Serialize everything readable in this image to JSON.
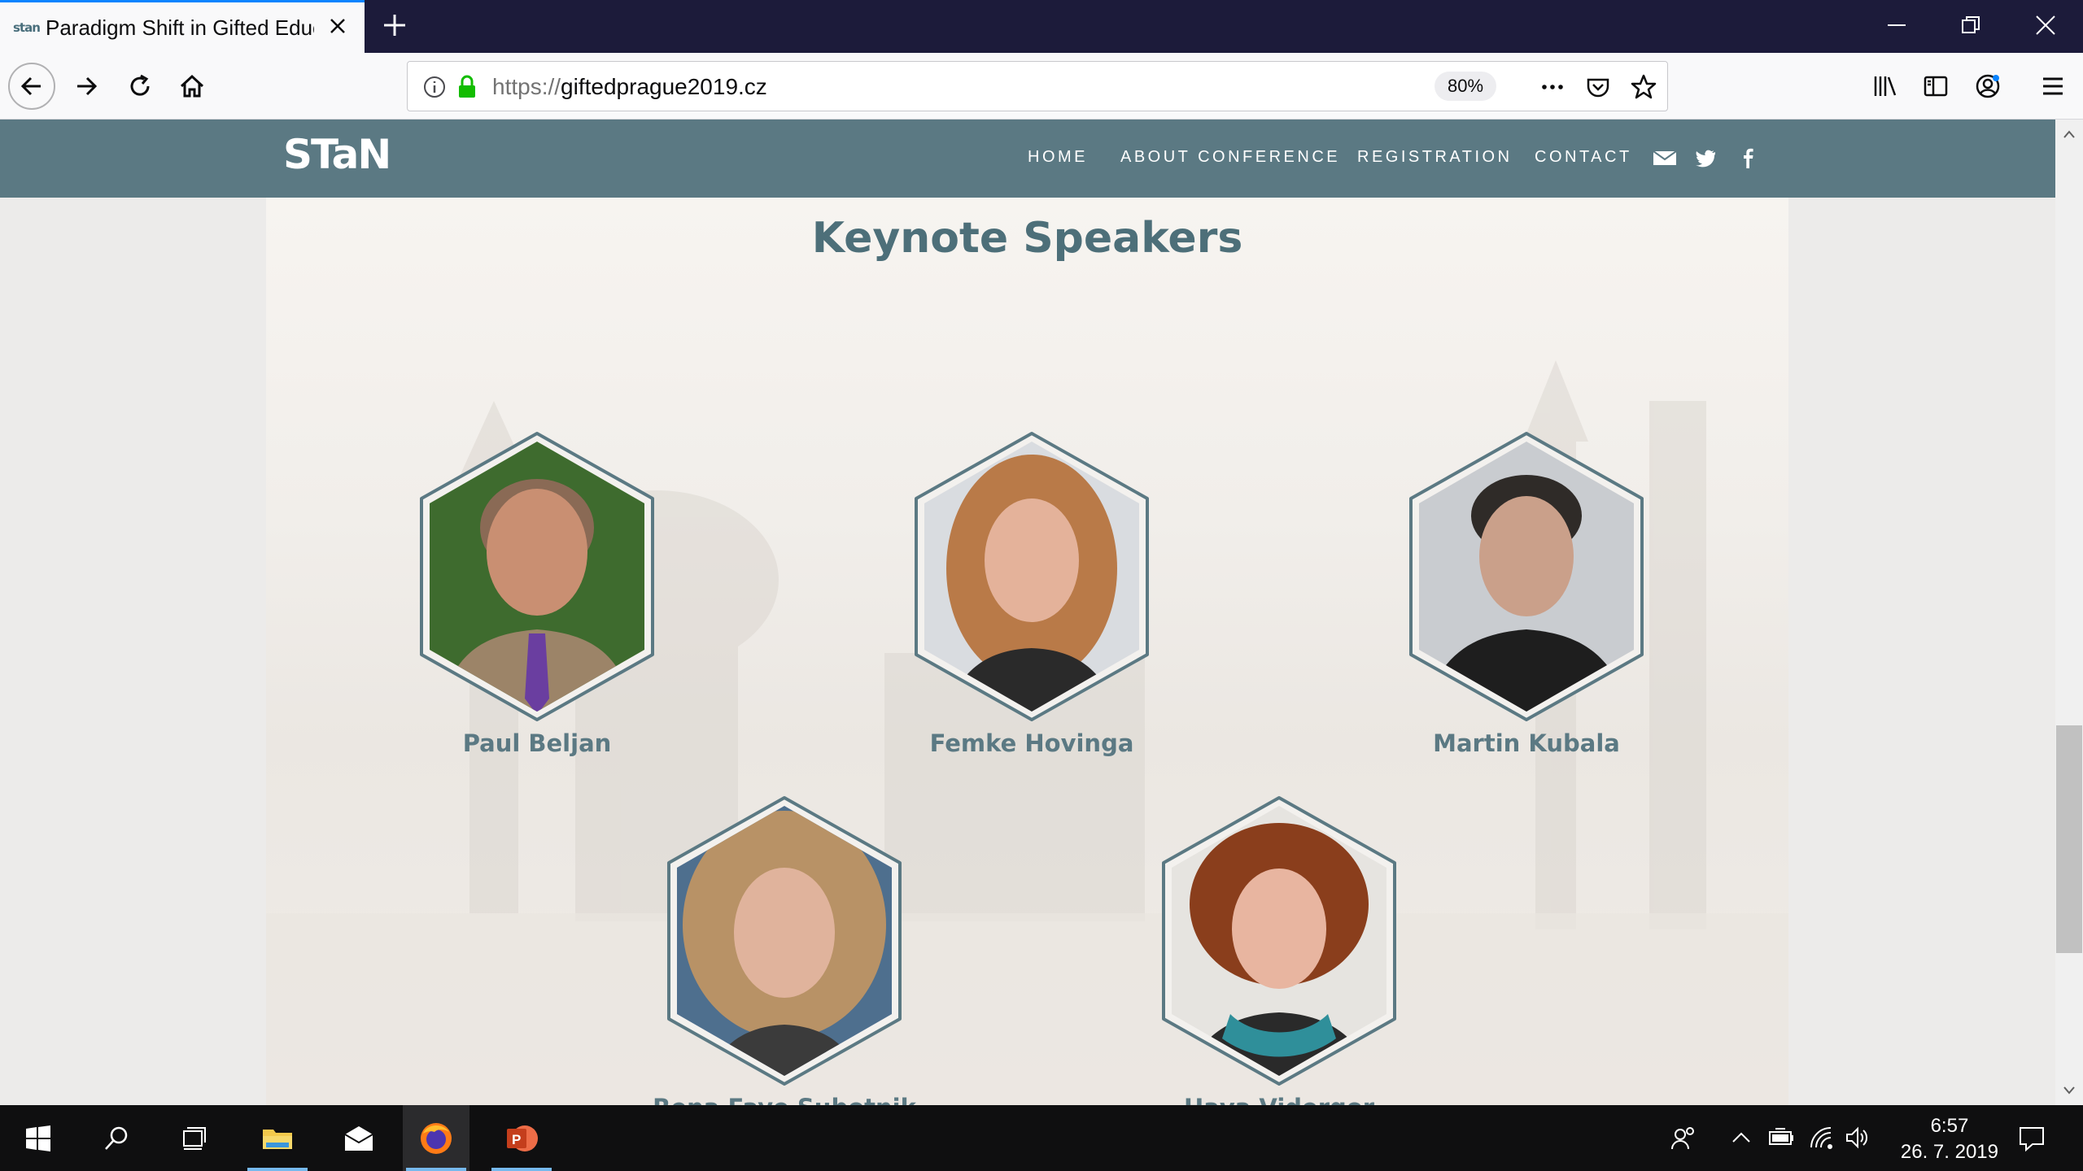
{
  "browser": {
    "tab": {
      "favicon": "stan",
      "title": "Paradigm Shift in Gifted Educat"
    },
    "url": {
      "scheme": "https://",
      "host": "giftedprague2019.cz"
    },
    "zoom": "80%",
    "icons": [
      "back-icon",
      "forward-icon",
      "reload-icon",
      "home-icon",
      "info-icon",
      "lock-icon",
      "more-icon",
      "pocket-icon",
      "star-icon",
      "library-icon",
      "sidebar-icon",
      "account-icon",
      "menu-icon"
    ]
  },
  "site": {
    "logo": "STaN",
    "menu": [
      "HOME",
      "ABOUT CONFERENCE",
      "REGISTRATION",
      "CONTACT"
    ],
    "social_icons": [
      "email-icon",
      "twitter-icon",
      "facebook-icon"
    ],
    "section_title": "Keynote Speakers",
    "speakers": [
      {
        "name": "Paul Beljan",
        "portrait": {
          "bg": "#3e6b2e",
          "skin": "#c98f72",
          "hair": "#8a6a55",
          "suit": "#9c8468",
          "tie": "#6a3ea0"
        }
      },
      {
        "name": "Femke Hovinga",
        "portrait": {
          "bg": "#d9dce0",
          "skin": "#e4b29a",
          "hair": "#b97a48",
          "suit": "#2a2a2a",
          "tie": "#2a2a2a"
        }
      },
      {
        "name": "Martin Kubala",
        "portrait": {
          "bg": "#c9ccd0",
          "skin": "#caa08a",
          "hair": "#2f2b28",
          "suit": "#1e1e1e",
          "tie": "#1e1e1e"
        }
      },
      {
        "name": "Rena Faye Subotnik",
        "portrait": {
          "bg": "#4e6f8e",
          "skin": "#e0b39c",
          "hair": "#b89266",
          "suit": "#3b3b3b",
          "tie": "#3b3b3b"
        }
      },
      {
        "name": "Hava Vidergor",
        "portrait": {
          "bg": "#e6e4e0",
          "skin": "#e8b5a0",
          "hair": "#8a3e1c",
          "suit": "#2a2a2a",
          "tie": "#2f8f9a"
        }
      }
    ]
  },
  "taskbar": {
    "items": [
      "windows-start-icon",
      "search-icon",
      "task-view-icon",
      "file-explorer-icon",
      "mail-icon",
      "firefox-icon",
      "powerpoint-icon"
    ],
    "tray_icons": [
      "people-icon",
      "chevron-up-icon",
      "battery-icon",
      "wifi-icon",
      "volume-icon",
      "notifications-icon"
    ],
    "time": "6:57",
    "date": "26. 7. 2019"
  }
}
